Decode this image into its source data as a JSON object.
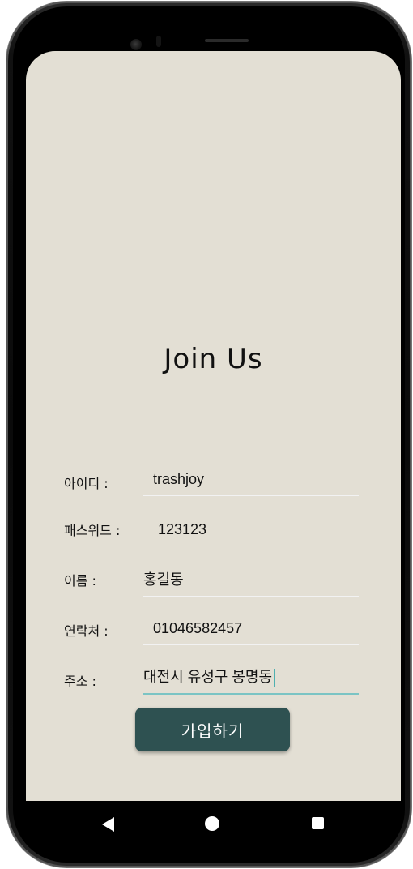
{
  "title": "Join Us",
  "form": {
    "fields": [
      {
        "label": "아이디 :",
        "value": "trashjoy"
      },
      {
        "label": "패스워드 :",
        "value": "123123"
      },
      {
        "label": "이름 :",
        "value": "홍길동"
      },
      {
        "label": "연락처 :",
        "value": "01046582457"
      },
      {
        "label": "주소 :",
        "value": "대전시 유성구 봉명동"
      }
    ],
    "submit_label": "가입하기"
  },
  "colors": {
    "background": "#e3dfd4",
    "button": "#2e5151",
    "active_underline": "#7bc4c4"
  },
  "nav": {
    "back_icon": "back-triangle-icon",
    "home_icon": "home-circle-icon",
    "recents_icon": "recents-square-icon"
  }
}
